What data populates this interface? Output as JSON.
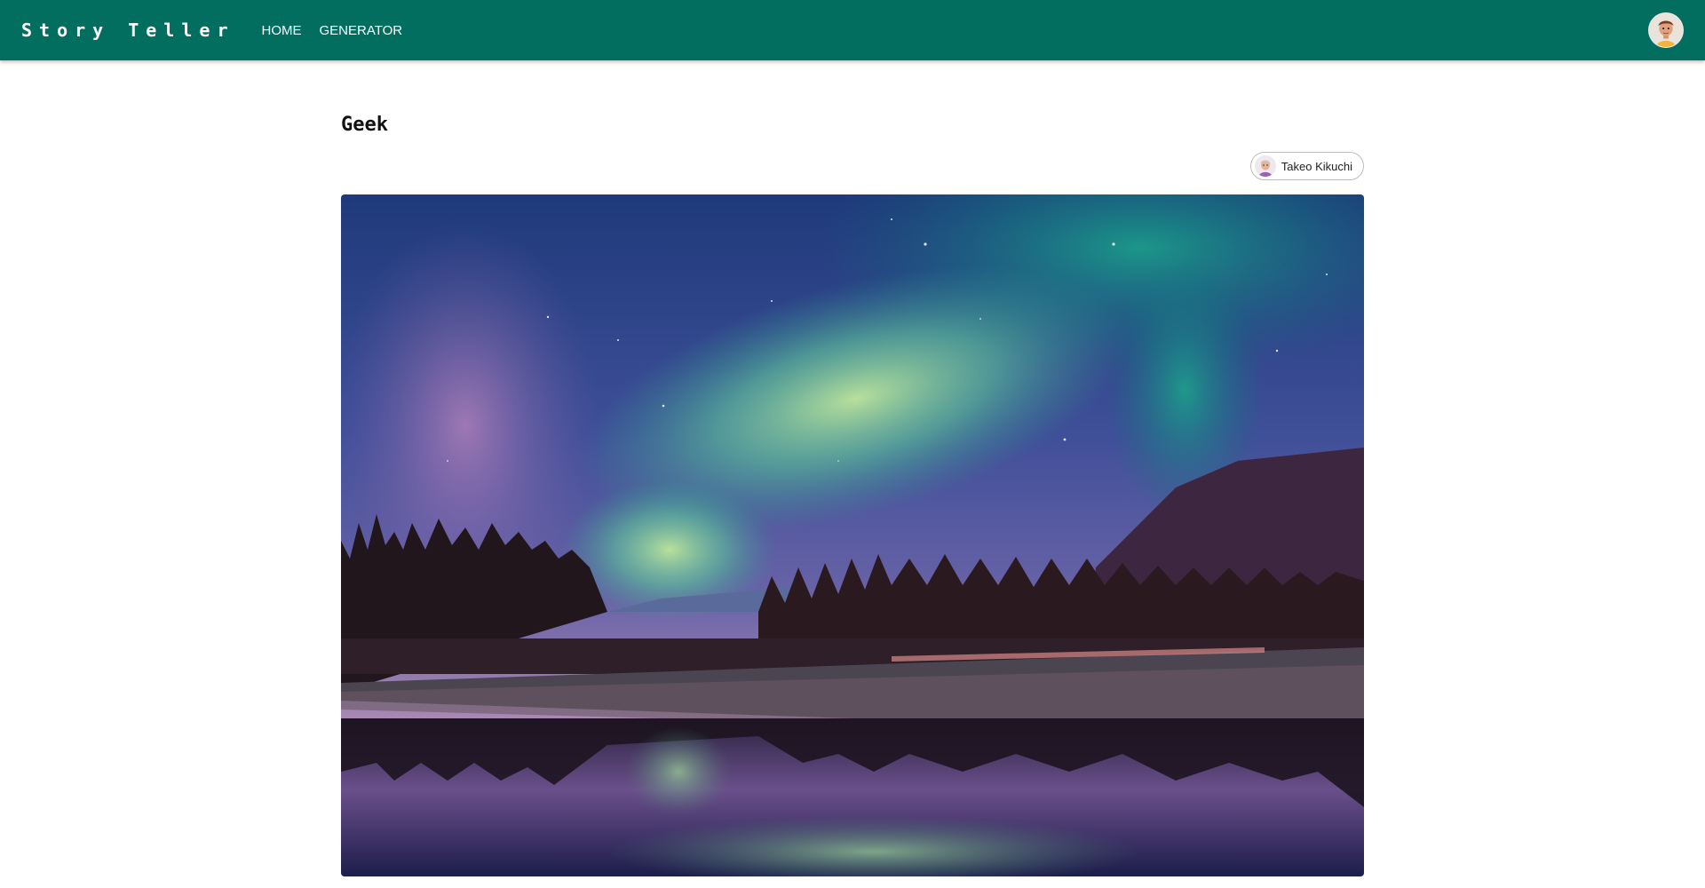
{
  "app": {
    "brand": "Story Teller",
    "nav": [
      {
        "label": "HOME"
      },
      {
        "label": "GENERATOR"
      }
    ],
    "user_avatar_icon": "user-avatar-icon"
  },
  "story": {
    "title": "Geek",
    "author": {
      "name": "Takeo Kikuchi",
      "avatar_icon": "author-avatar-icon"
    },
    "image_subject": "aurora-landscape"
  },
  "colors": {
    "appbar": "#016e60",
    "background": "#ffffff"
  }
}
